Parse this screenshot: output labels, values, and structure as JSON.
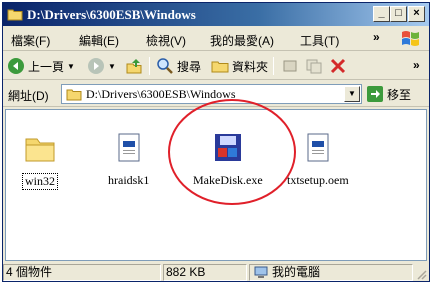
{
  "window": {
    "title": "D:\\Drivers\\6300ESB\\Windows",
    "buttons": {
      "minimize": "_",
      "maximize": "□",
      "close": "×"
    }
  },
  "menubar": {
    "items": [
      {
        "label": "檔案(F)"
      },
      {
        "label": "編輯(E)"
      },
      {
        "label": "檢視(V)"
      },
      {
        "label": "我的最愛(A)"
      },
      {
        "label": "工具(T)"
      }
    ],
    "overflow": "»"
  },
  "toolbar": {
    "back_label": "上一頁",
    "search_label": "搜尋",
    "folders_label": "資料夾",
    "overflow": "»"
  },
  "addressbar": {
    "label": "網址(D)",
    "value": "D:\\Drivers\\6300ESB\\Windows",
    "go_label": "移至"
  },
  "files": [
    {
      "name": "win32",
      "type": "folder"
    },
    {
      "name": "hraidsk1",
      "type": "document"
    },
    {
      "name": "MakeDisk.exe",
      "type": "executable"
    },
    {
      "name": "txtsetup.oem",
      "type": "document"
    }
  ],
  "statusbar": {
    "object_count": "4 個物件",
    "size": "882 KB",
    "location": "我的電腦"
  },
  "colors": {
    "title_start": "#0a246a",
    "title_end": "#a6caf0",
    "highlight_circle": "#e0202a"
  }
}
